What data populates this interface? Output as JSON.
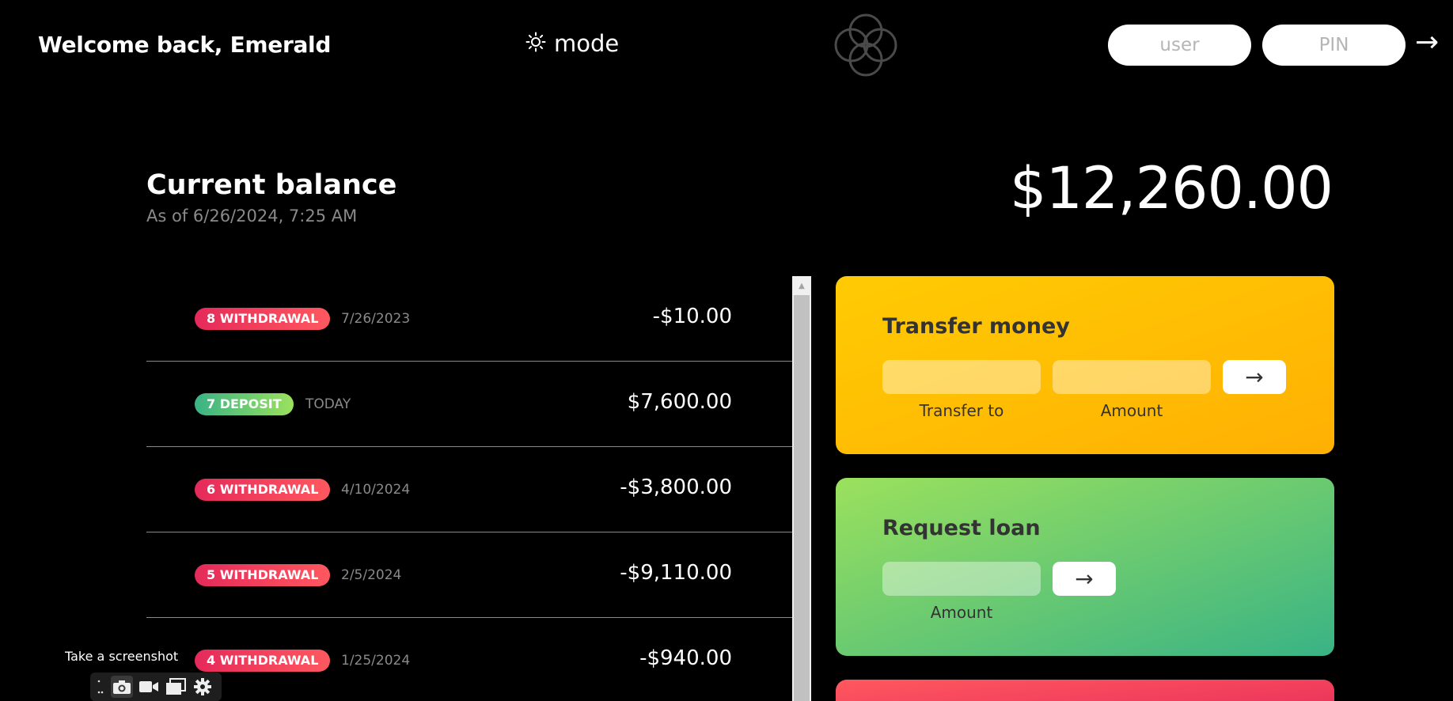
{
  "header": {
    "welcome": "Welcome back, Emerald",
    "mode_label": "mode",
    "user_placeholder": "user",
    "pin_placeholder": "PIN",
    "login_arrow": "→"
  },
  "balance": {
    "label": "Current balance",
    "date": "As of 6/26/2024, 7:25 AM",
    "value": "$12,260.00"
  },
  "movements": [
    {
      "type": "withdrawal",
      "badge": "8 WITHDRAWAL",
      "date": "7/26/2023",
      "amount": "-$10.00"
    },
    {
      "type": "deposit",
      "badge": "7 DEPOSIT",
      "date": "TODAY",
      "amount": "$7,600.00"
    },
    {
      "type": "withdrawal",
      "badge": "6 WITHDRAWAL",
      "date": "4/10/2024",
      "amount": "-$3,800.00"
    },
    {
      "type": "withdrawal",
      "badge": "5 WITHDRAWAL",
      "date": "2/5/2024",
      "amount": "-$9,110.00"
    },
    {
      "type": "withdrawal",
      "badge": "4 WITHDRAWAL",
      "date": "1/25/2024",
      "amount": "-$940.00"
    }
  ],
  "operations": {
    "transfer": {
      "title": "Transfer money",
      "to_label": "Transfer to",
      "amount_label": "Amount",
      "button": "→"
    },
    "loan": {
      "title": "Request loan",
      "amount_label": "Amount",
      "button": "→"
    }
  },
  "screenshot_tool": {
    "label": "Take a screenshot",
    "icons": [
      "dots-icon",
      "camera-icon",
      "video-icon",
      "windows-icon",
      "gear-icon"
    ]
  },
  "colors": {
    "background": "#000000",
    "withdrawal": "#e52a5a",
    "deposit": "#39b385",
    "transfer": "#ffb003",
    "loan": "#9be15d"
  }
}
